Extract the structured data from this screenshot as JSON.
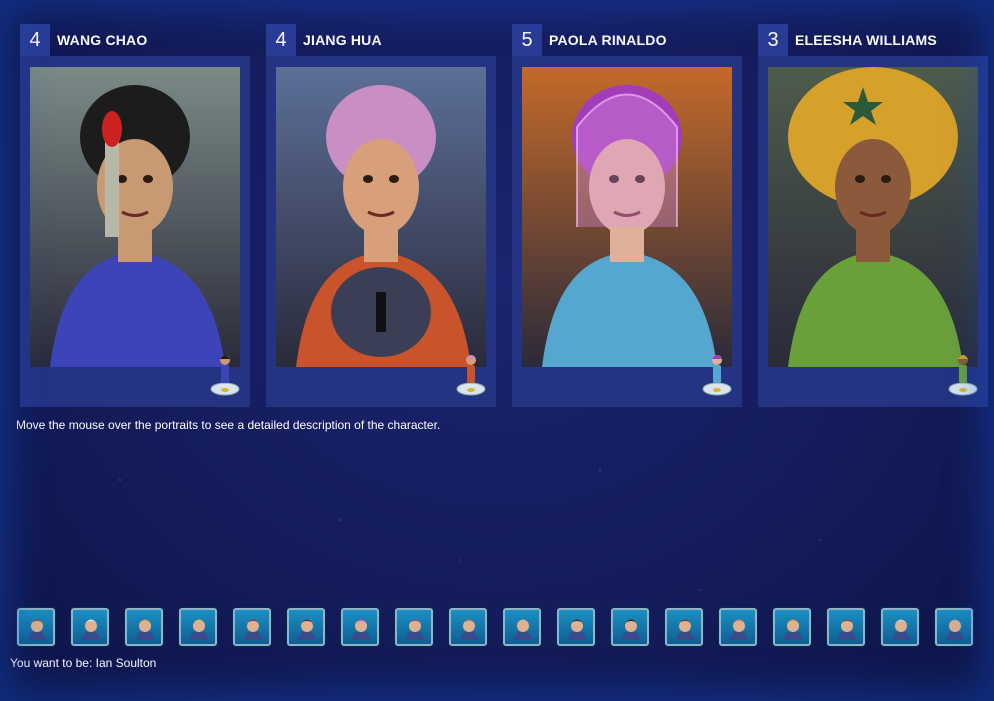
{
  "characters": [
    {
      "number": "4",
      "name": "WANG CHAO",
      "hair": "#1c1c1c",
      "skin": "#c79a73",
      "outfit": "#3c44b8",
      "bg": "#7a8a86"
    },
    {
      "number": "4",
      "name": "JIANG HUA",
      "hair": "#c98ec3",
      "skin": "#d8a07a",
      "outfit": "#c9532a",
      "bg": "#5c6f98"
    },
    {
      "number": "5",
      "name": "PAOLA RINALDO",
      "hair": "#a23cb8",
      "skin": "#e0b19a",
      "outfit": "#56a7cf",
      "bg": "#c46a2a"
    },
    {
      "number": "3",
      "name": "ELEESHA WILLIAMS",
      "hair": "#d6a12a",
      "skin": "#8a5a3a",
      "outfit": "#6aa03a",
      "bg": "#4e5c4c"
    }
  ],
  "description_hint": "Move the mouse over the portraits to see a detailed description of the character.",
  "tray": {
    "icons": [
      "character-face-icon",
      "character-face-icon",
      "character-face-icon",
      "character-face-icon",
      "character-face-icon",
      "character-face-icon",
      "character-face-icon",
      "character-face-icon",
      "character-face-icon",
      "character-face-icon",
      "character-face-icon",
      "character-face-icon",
      "character-face-icon",
      "character-face-icon",
      "character-face-icon",
      "character-face-icon",
      "character-face-icon",
      "character-face-icon"
    ],
    "face_colors": [
      "#8b5a3a",
      "#e6e6e6",
      "#e0a040",
      "#d8c060",
      "#7a3a6a",
      "#5a2a3a",
      "#c060c0",
      "#a04a7a",
      "#c08060",
      "#e0b090",
      "#303030",
      "#202020",
      "#6a3a2a",
      "#d09070",
      "#e09a30",
      "#7a4a3a",
      "#d0d0e0",
      "#c0a0a0"
    ]
  },
  "selection": {
    "prefix": "You want to be: ",
    "name": "Ian Soulton",
    "full": "You want to be: Ian Soulton"
  }
}
